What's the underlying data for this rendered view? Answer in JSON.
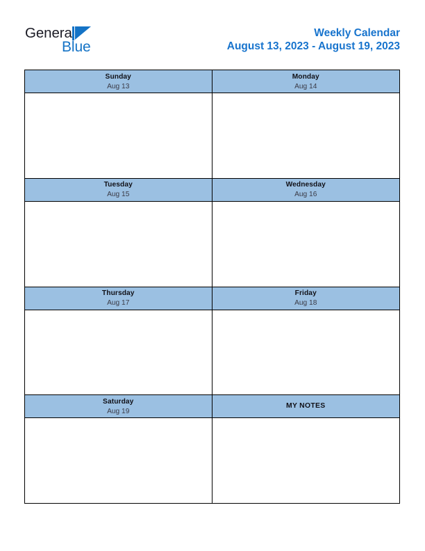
{
  "brand": {
    "name_part1": "General",
    "name_part2": "Blue",
    "triangle_color": "#1473c6"
  },
  "header": {
    "title": "Weekly Calendar",
    "date_range": "August 13, 2023 - August 19, 2023",
    "title_color": "#1874cd"
  },
  "calendar": {
    "header_bg": "#9bc0e2",
    "border_color": "#000000",
    "weeks": [
      {
        "left": {
          "day": "Sunday",
          "date": "Aug 13",
          "note": ""
        },
        "right": {
          "day": "Monday",
          "date": "Aug 14",
          "note": ""
        }
      },
      {
        "left": {
          "day": "Tuesday",
          "date": "Aug 15",
          "note": ""
        },
        "right": {
          "day": "Wednesday",
          "date": "Aug 16",
          "note": ""
        }
      },
      {
        "left": {
          "day": "Thursday",
          "date": "Aug 17",
          "note": ""
        },
        "right": {
          "day": "Friday",
          "date": "Aug 18",
          "note": ""
        }
      },
      {
        "left": {
          "day": "Saturday",
          "date": "Aug 19",
          "note": ""
        },
        "right": {
          "day": "MY NOTES",
          "date": "",
          "note": ""
        }
      }
    ]
  }
}
